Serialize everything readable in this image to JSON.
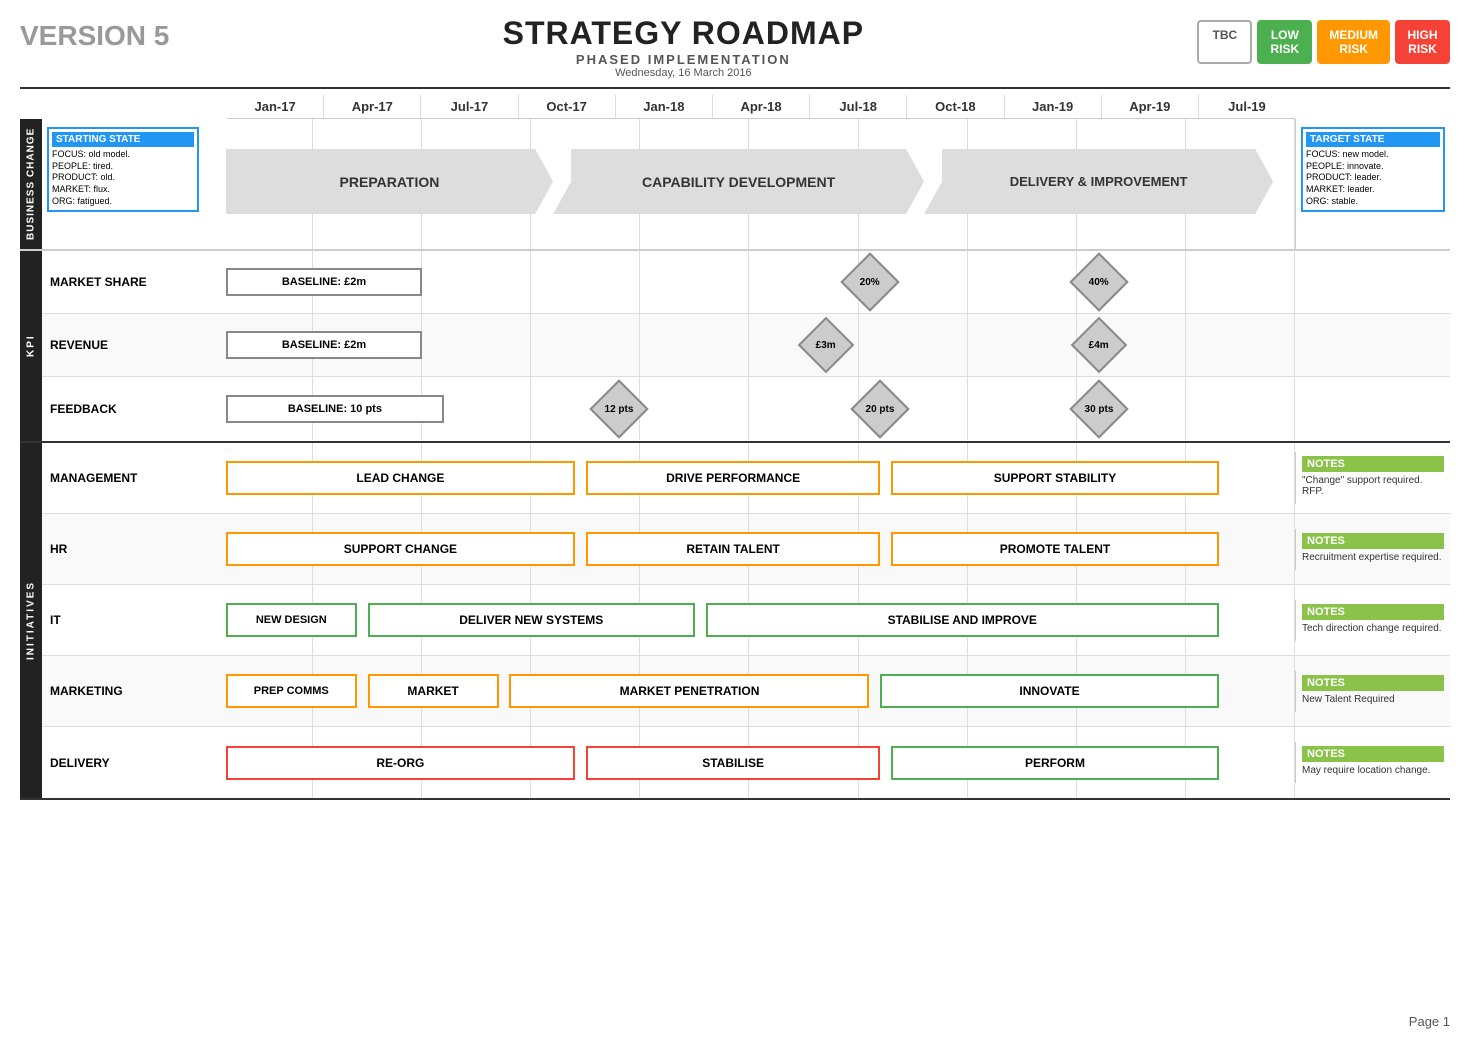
{
  "header": {
    "version": "VERSION 5",
    "title": "STRATEGY ROADMAP",
    "subtitle": "PHASED IMPLEMENTATION",
    "date": "Wednesday, 16 March 2016",
    "risk_badges": [
      {
        "label": "TBC",
        "class": "risk-tbc"
      },
      {
        "label": "LOW\nRISK",
        "class": "risk-low",
        "line1": "LOW",
        "line2": "RISK"
      },
      {
        "label": "MEDIUM\nRISK",
        "class": "risk-medium",
        "line1": "MEDIUM",
        "line2": "RISK"
      },
      {
        "label": "HIGH\nRISK",
        "class": "risk-high",
        "line1": "HIGH",
        "line2": "RISK"
      }
    ]
  },
  "timeline": {
    "columns": [
      "Jan-17",
      "Apr-17",
      "Jul-17",
      "Oct-17",
      "Jan-18",
      "Apr-18",
      "Jul-18",
      "Oct-18",
      "Jan-19",
      "Apr-19",
      "Jul-19"
    ]
  },
  "business_change": {
    "section_label": "BUSINESS CHANGE",
    "starting_state": {
      "title": "STARTING STATE",
      "lines": [
        "FOCUS: old model.",
        "PEOPLE: tired.",
        "PRODUCT: old.",
        "MARKET: flux.",
        "ORG: fatigued."
      ]
    },
    "target_state": {
      "title": "TARGET STATE",
      "lines": [
        "FOCUS: new model.",
        "PEOPLE: innovate.",
        "PRODUCT: leader.",
        "MARKET: leader.",
        "ORG: stable."
      ]
    },
    "phases": [
      {
        "label": "PREPARATION",
        "start_pct": 8,
        "width_pct": 27,
        "type": "first"
      },
      {
        "label": "CAPABILITY DEVELOPMENT",
        "start_pct": 35,
        "width_pct": 32,
        "type": "middle"
      },
      {
        "label": "DELIVERY & IMPROVEMENT",
        "start_pct": 67,
        "width_pct": 30,
        "type": "last"
      }
    ]
  },
  "kpi": {
    "section_label": "KPI",
    "rows": [
      {
        "label": "MARKET SHARE",
        "baseline": {
          "label": "BASELINE: £2m",
          "pct": 8
        },
        "markers": [
          {
            "label": "20%",
            "pct": 62
          },
          {
            "label": "40%",
            "pct": 82
          }
        ]
      },
      {
        "label": "REVENUE",
        "baseline": {
          "label": "BASELINE: £2m",
          "pct": 8
        },
        "markers": [
          {
            "label": "£3m",
            "pct": 57
          },
          {
            "label": "£4m",
            "pct": 82
          }
        ]
      },
      {
        "label": "FEEDBACK",
        "baseline": {
          "label": "BASELINE: 10 pts",
          "pct": 8
        },
        "markers": [
          {
            "label": "12 pts",
            "pct": 38
          },
          {
            "label": "20 pts",
            "pct": 62
          },
          {
            "label": "30 pts",
            "pct": 82
          }
        ]
      }
    ]
  },
  "initiatives": {
    "section_label": "INITIATIVES",
    "rows": [
      {
        "label": "MANAGEMENT",
        "items": [
          {
            "label": "LEAD CHANGE",
            "start_pct": 7,
            "width_pct": 30,
            "color": "orange"
          },
          {
            "label": "DRIVE PERFORMANCE",
            "start_pct": 37,
            "width_pct": 27,
            "color": "orange"
          },
          {
            "label": "SUPPORT STABILITY",
            "start_pct": 64,
            "width_pct": 29,
            "color": "orange"
          }
        ],
        "notes_title": "NOTES",
        "notes_text": "\"Change\" support required. RFP."
      },
      {
        "label": "HR",
        "items": [
          {
            "label": "SUPPORT CHANGE",
            "start_pct": 7,
            "width_pct": 30,
            "color": "orange"
          },
          {
            "label": "RETAIN TALENT",
            "start_pct": 37,
            "width_pct": 27,
            "color": "orange"
          },
          {
            "label": "PROMOTE TALENT",
            "start_pct": 64,
            "width_pct": 29,
            "color": "orange"
          }
        ],
        "notes_title": "NOTES",
        "notes_text": "Recruitment expertise required."
      },
      {
        "label": "IT",
        "items": [
          {
            "label": "NEW DESIGN",
            "start_pct": 7,
            "width_pct": 13,
            "color": "green"
          },
          {
            "label": "DELIVER NEW SYSTEMS",
            "start_pct": 20,
            "width_pct": 27,
            "color": "green"
          },
          {
            "label": "STABILISE AND IMPROVE",
            "start_pct": 47,
            "width_pct": 46,
            "color": "green"
          }
        ],
        "notes_title": "NOTES",
        "notes_text": "Tech direction change required."
      },
      {
        "label": "MARKETING",
        "items": [
          {
            "label": "PREP COMMS",
            "start_pct": 7,
            "width_pct": 13,
            "color": "orange"
          },
          {
            "label": "MARKET",
            "start_pct": 20,
            "width_pct": 13,
            "color": "orange"
          },
          {
            "label": "MARKET PENETRATION",
            "start_pct": 33,
            "width_pct": 30,
            "color": "orange"
          },
          {
            "label": "INNOVATE",
            "start_pct": 63,
            "width_pct": 30,
            "color": "green"
          }
        ],
        "notes_title": "NOTES",
        "notes_text": "New Talent Required"
      },
      {
        "label": "DELIVERY",
        "items": [
          {
            "label": "RE-ORG",
            "start_pct": 7,
            "width_pct": 30,
            "color": "red"
          },
          {
            "label": "STABILISE",
            "start_pct": 37,
            "width_pct": 27,
            "color": "red"
          },
          {
            "label": "PERFORM",
            "start_pct": 64,
            "width_pct": 29,
            "color": "green"
          }
        ],
        "notes_title": "NOTES",
        "notes_text": "May require location change."
      }
    ]
  },
  "page_number": "Page 1"
}
